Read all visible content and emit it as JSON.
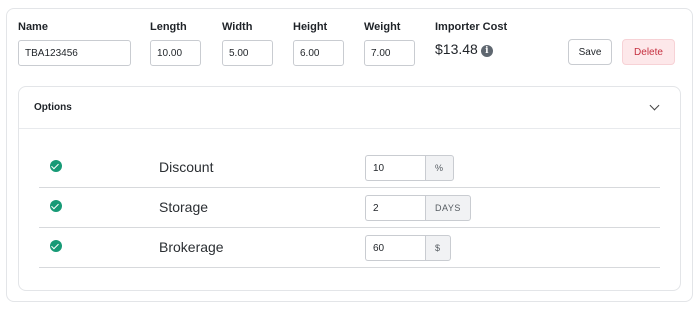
{
  "fields": {
    "name": {
      "label": "Name",
      "value": "TBA123456"
    },
    "length": {
      "label": "Length",
      "value": "10.00"
    },
    "width": {
      "label": "Width",
      "value": "5.00"
    },
    "height": {
      "label": "Height",
      "value": "6.00"
    },
    "weight": {
      "label": "Weight",
      "value": "7.00"
    },
    "importer_cost": {
      "label": "Importer Cost",
      "value": "$13.48",
      "icon": "info-icon"
    }
  },
  "actions": {
    "save_label": "Save",
    "delete_label": "Delete"
  },
  "options": {
    "title": "Options",
    "collapse_icon": "chevron-down-icon",
    "items": [
      {
        "label": "Discount",
        "checked": true,
        "value": "10",
        "unit": "%"
      },
      {
        "label": "Storage",
        "checked": true,
        "value": "2",
        "unit": "DAYS"
      },
      {
        "label": "Brokerage",
        "checked": true,
        "value": "60",
        "unit": "$"
      }
    ]
  },
  "colors": {
    "check": "#179a76",
    "delete_bg": "#fde8ea",
    "delete_text": "#c52f3f",
    "border": "#c9ccd1"
  }
}
